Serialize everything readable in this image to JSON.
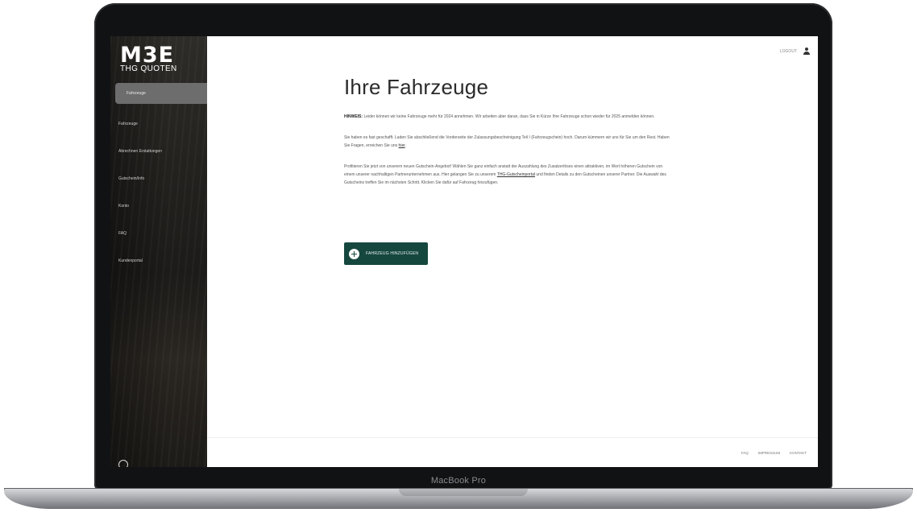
{
  "device": {
    "label": "MacBook Pro"
  },
  "brand": {
    "mark": "M3E",
    "subtitle": "THG QUOTEN"
  },
  "sidebar": {
    "items": [
      {
        "label": "Fahrzeuge",
        "active": true
      },
      {
        "label": "Fahrzeuge"
      },
      {
        "label": "Abrechnen Erstattungen"
      },
      {
        "label": "Gutschein/Info"
      },
      {
        "label": "Konto"
      },
      {
        "label": "FAQ"
      },
      {
        "label": "Kundenportal"
      }
    ]
  },
  "header": {
    "logout_label": "LOGOUT"
  },
  "main": {
    "title": "Ihre Fahrzeuge",
    "notice_label": "HINWEIS:",
    "notice_text": "Leider können wir keine Fahrzeuge mehr für 2024 annehmen. Wir arbeiten aber daran, dass Sie in Kürze Ihre Fahrzeuge schon wieder für 2025 anmelden können.",
    "para2": "Sie haben es fast geschafft. Laden Sie abschließend die Vorderseite der Zulassungsbescheinigung Teil I (Fahrzeugschein) hoch. Darum kümmern wir uns für Sie um den Rest. Haben Sie Fragen, erreichen Sie uns",
    "para2_link": "hier",
    "para3_start": "Profitieren Sie jetzt von unserem neuen Gutschein-Angebot! Wählen Sie ganz einfach anstatt der Auszahlung des Zusatzerlöses einen attraktiven, im Wert höheren Gutschein von einem unserer nachhaltigen Partnerunternehmen aus. Hier gelangen Sie zu unserem",
    "para3_link": "THG-Gutscheinportal",
    "para3_end": "und finden Details zu den Gutscheinen unserer Partner. Die Auswahl des Gutscheins treffen Sie im nächsten Schritt. Klicken Sie dafür auf Fahrzeug hinzufügen.",
    "add_button": "FAHRZEUG HINZUFÜGEN"
  },
  "footer": {
    "links": [
      "FAQ",
      "IMPRESSUM",
      "KONTAKT"
    ]
  },
  "colors": {
    "accent": "#16473f",
    "sidebar_active": "#6d6d6d"
  }
}
